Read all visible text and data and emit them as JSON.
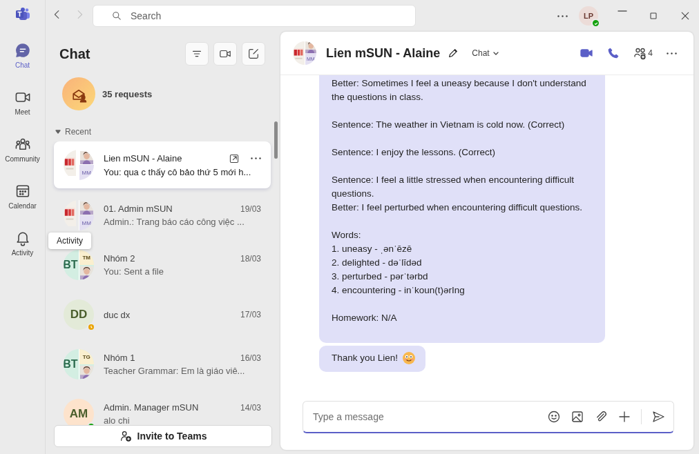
{
  "app_bar": {
    "search": {
      "placeholder": "Search"
    },
    "user": {
      "initials": "LP",
      "status": {
        "kind": "available",
        "color": "#13a10e"
      }
    }
  },
  "rail": [
    {
      "label": "Chat",
      "selected": true
    },
    {
      "label": "Meet",
      "selected": false
    },
    {
      "label": "Community",
      "selected": false
    },
    {
      "label": "Calendar",
      "selected": false
    },
    {
      "label": "Activity",
      "selected": false
    }
  ],
  "tooltip": "Activity",
  "chat_list": {
    "title": "Chat",
    "requests": "35 requests",
    "section": "Recent",
    "items": [
      {
        "name": "Lien mSUN - Alaine",
        "preview": "You: qua c thấy cô bảo thứ 5 mới h...",
        "selected": true,
        "avatar": {
          "kind": "logo",
          "initials": "MM"
        }
      },
      {
        "name": "01. Admin mSUN",
        "date": "19/03",
        "preview": "Admin.: Trang báo cáo công việc ...",
        "selected": false,
        "avatar": {
          "kind": "logo",
          "initials": "MM"
        }
      },
      {
        "name": "Nhóm 2",
        "date": "18/03",
        "preview": "You: Sent a file",
        "selected": false,
        "avatar": {
          "kind": "group",
          "initials": "BT",
          "sub": "TM",
          "color": "#d3eee2"
        }
      },
      {
        "name": "duc dx",
        "date": "17/03",
        "selected": false,
        "status": {
          "kind": "away",
          "color": "#eaa300"
        },
        "avatar": {
          "kind": "initials",
          "initials": "DD",
          "color": "#e3ead8"
        }
      },
      {
        "name": "Nhóm 1",
        "date": "16/03",
        "preview": "Teacher Grammar: Em là giáo viê...",
        "selected": false,
        "avatar": {
          "kind": "group",
          "initials": "BT",
          "sub": "TG",
          "color": "#d3eee2"
        }
      },
      {
        "name": "Admin. Manager mSUN",
        "date": "14/03",
        "preview": "alo chi",
        "selected": false,
        "status": {
          "kind": "available",
          "color": "#13a10e"
        },
        "avatar": {
          "kind": "initials",
          "initials": "AM",
          "color": "#fde3cc"
        }
      }
    ]
  },
  "invite_button": "Invite to Teams",
  "conversation": {
    "avatar_initials": "MM",
    "title": "Lien mSUN - Alaine",
    "tab": "Chat",
    "participants": "4",
    "messages": [
      {
        "paragraphs": [
          "Better: Sometimes I feel a uneasy because I don't understand the questions in class.",
          "Sentence: The weather in Vietnam is cold now. (Correct)",
          "Sentence: I enjoy the lessons. (Correct)",
          "Sentence: I feel a little stressed when encountering difficult questions.\nBetter: I feel perturbed when encountering difficult questions.",
          "Words:\n1. uneasy - ˌənˈēzē\n2. delighted - dəˈlīdəd\n3. perturbed - pərˈtərbd\n4. encountering - inˈkoun(t)ərIng",
          "Homework: N/A"
        ]
      },
      {
        "text": "Thank you Lien!",
        "emoji": true
      }
    ],
    "composer": {
      "placeholder": "Type a message"
    }
  }
}
